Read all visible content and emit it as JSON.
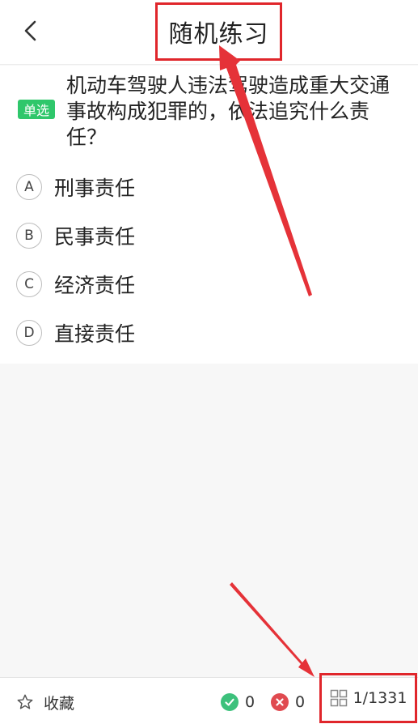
{
  "header": {
    "title": "随机练习"
  },
  "question": {
    "type_badge": "单选",
    "text": "机动车驾驶人违法驾驶造成重大交通事故构成犯罪的，依法追究什么责任？",
    "options": [
      {
        "letter": "A",
        "text": "刑事责任"
      },
      {
        "letter": "B",
        "text": "民事责任"
      },
      {
        "letter": "C",
        "text": "经济责任"
      },
      {
        "letter": "D",
        "text": "直接责任"
      }
    ]
  },
  "footer": {
    "favorite_label": "收藏",
    "correct_count": "0",
    "wrong_count": "0",
    "progress": "1/1331"
  },
  "colors": {
    "accent_green": "#2fc76b",
    "correct_green": "#3dc17c",
    "wrong_red": "#e04a50",
    "annotation_red": "#e0262b"
  },
  "icons": {
    "back": "chevron-left-icon",
    "favorite": "star-outline-icon",
    "correct": "check-circle-icon",
    "wrong": "close-circle-icon",
    "grid": "grid-icon"
  }
}
